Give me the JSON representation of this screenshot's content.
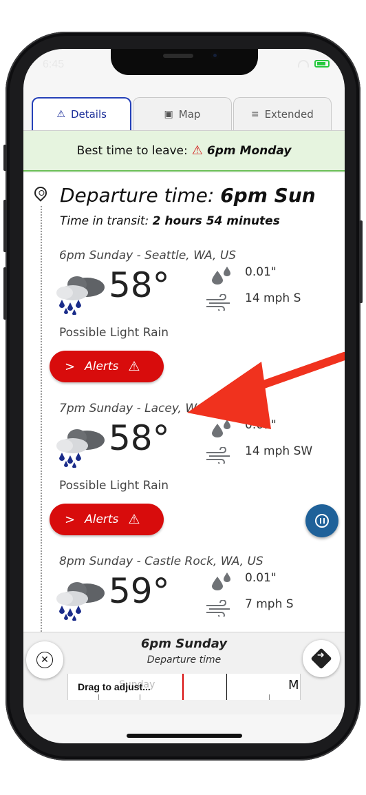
{
  "status_bar": {
    "time": "6:45"
  },
  "tabs": [
    {
      "label": "Details",
      "icon": "warning-sign-icon",
      "active": true
    },
    {
      "label": "Map",
      "icon": "image-icon",
      "active": false
    },
    {
      "label": "Extended",
      "icon": "menu-lines-icon",
      "active": false
    }
  ],
  "banner": {
    "label": "Best time to leave:",
    "value": "6pm Monday",
    "icon": "warning-icon",
    "color": "#d31818"
  },
  "departure": {
    "label": "Departure time:",
    "value": "6pm Sun",
    "transit_label": "Time in transit:",
    "transit_value": "2 hours 54 minutes"
  },
  "stops": [
    {
      "header": "6pm Sunday - Seattle, WA, US",
      "temp": "58°",
      "precip": "0.01\"",
      "wind": "14 mph S",
      "condition": "Possible Light Rain",
      "alerts_label": "Alerts"
    },
    {
      "header": "7pm Sunday - Lacey, WA, US",
      "temp": "58°",
      "precip": "0.01\"",
      "wind": "14 mph SW",
      "condition": "Possible Light Rain",
      "alerts_label": "Alerts"
    },
    {
      "header": "8pm Sunday - Castle Rock, WA, US",
      "temp": "59°",
      "precip": "0.01\"",
      "wind": "7 mph S"
    }
  ],
  "bottom": {
    "selected_time": "6pm Sunday",
    "selected_sub": "Departure time",
    "slider_hint": "Drag to adjust...",
    "slider_faded": "Sunday",
    "slider_day": "M"
  },
  "colors": {
    "accent_blue": "#2540b8",
    "alert_red": "#d80c0c",
    "banner_green": "#e6f4df",
    "pause_blue": "#1f6199"
  }
}
